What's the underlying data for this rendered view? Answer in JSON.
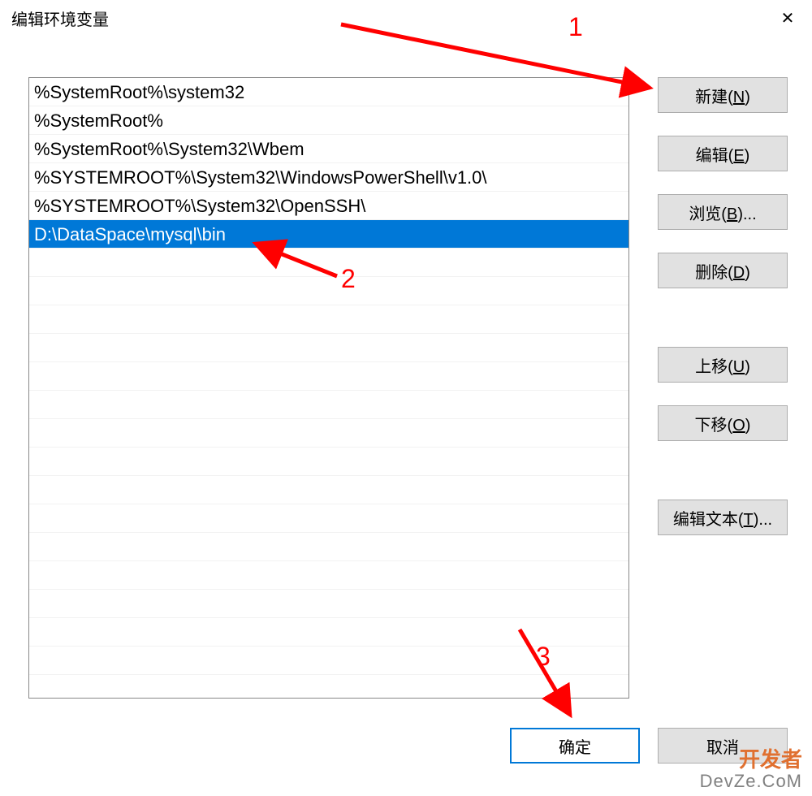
{
  "window": {
    "title": "编辑环境变量",
    "close_glyph": "✕"
  },
  "list": {
    "items": [
      {
        "text": "%SystemRoot%\\system32",
        "selected": false
      },
      {
        "text": "%SystemRoot%",
        "selected": false
      },
      {
        "text": "%SystemRoot%\\System32\\Wbem",
        "selected": false
      },
      {
        "text": "%SYSTEMROOT%\\System32\\WindowsPowerShell\\v1.0\\",
        "selected": false
      },
      {
        "text": "%SYSTEMROOT%\\System32\\OpenSSH\\",
        "selected": false
      },
      {
        "text": "D:\\DataSpace\\mysql\\bin",
        "selected": true
      }
    ],
    "empty_rows": 15
  },
  "sidebar": {
    "new": "新建(N)",
    "edit": "编辑(E)",
    "browse": "浏览(B)...",
    "delete": "删除(D)",
    "move_up": "上移(U)",
    "move_down": "下移(O)",
    "edit_text": "编辑文本(T)..."
  },
  "bottom": {
    "ok": "确定",
    "cancel": "取消"
  },
  "annotations": {
    "n1": "1",
    "n2": "2",
    "n3": "3"
  },
  "watermark": {
    "line1": "开发者",
    "line2": "DevZe.CoM"
  }
}
